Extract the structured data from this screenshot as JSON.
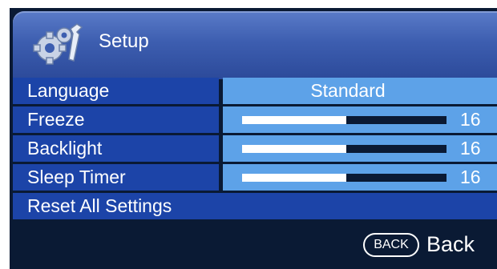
{
  "header": {
    "title": "Setup",
    "icon": "gears-wrench-icon"
  },
  "menu": [
    {
      "label": "Language",
      "type": "text",
      "value": "Standard"
    },
    {
      "label": "Freeze",
      "type": "slider",
      "value": "16",
      "fill_fraction": 0.51
    },
    {
      "label": "Backlight",
      "type": "slider",
      "value": "16",
      "fill_fraction": 0.51
    },
    {
      "label": "Sleep Timer",
      "type": "slider",
      "value": "16",
      "fill_fraction": 0.51
    },
    {
      "label": "Reset All Settings",
      "type": "action"
    }
  ],
  "footer": {
    "back_key": "BACK",
    "back_label": "Back"
  },
  "colors": {
    "background": "#0a1a34",
    "label_row": "#1c44a8",
    "value_row": "#5da2e8",
    "header": "#3d5eb0",
    "text": "#ffffff"
  }
}
